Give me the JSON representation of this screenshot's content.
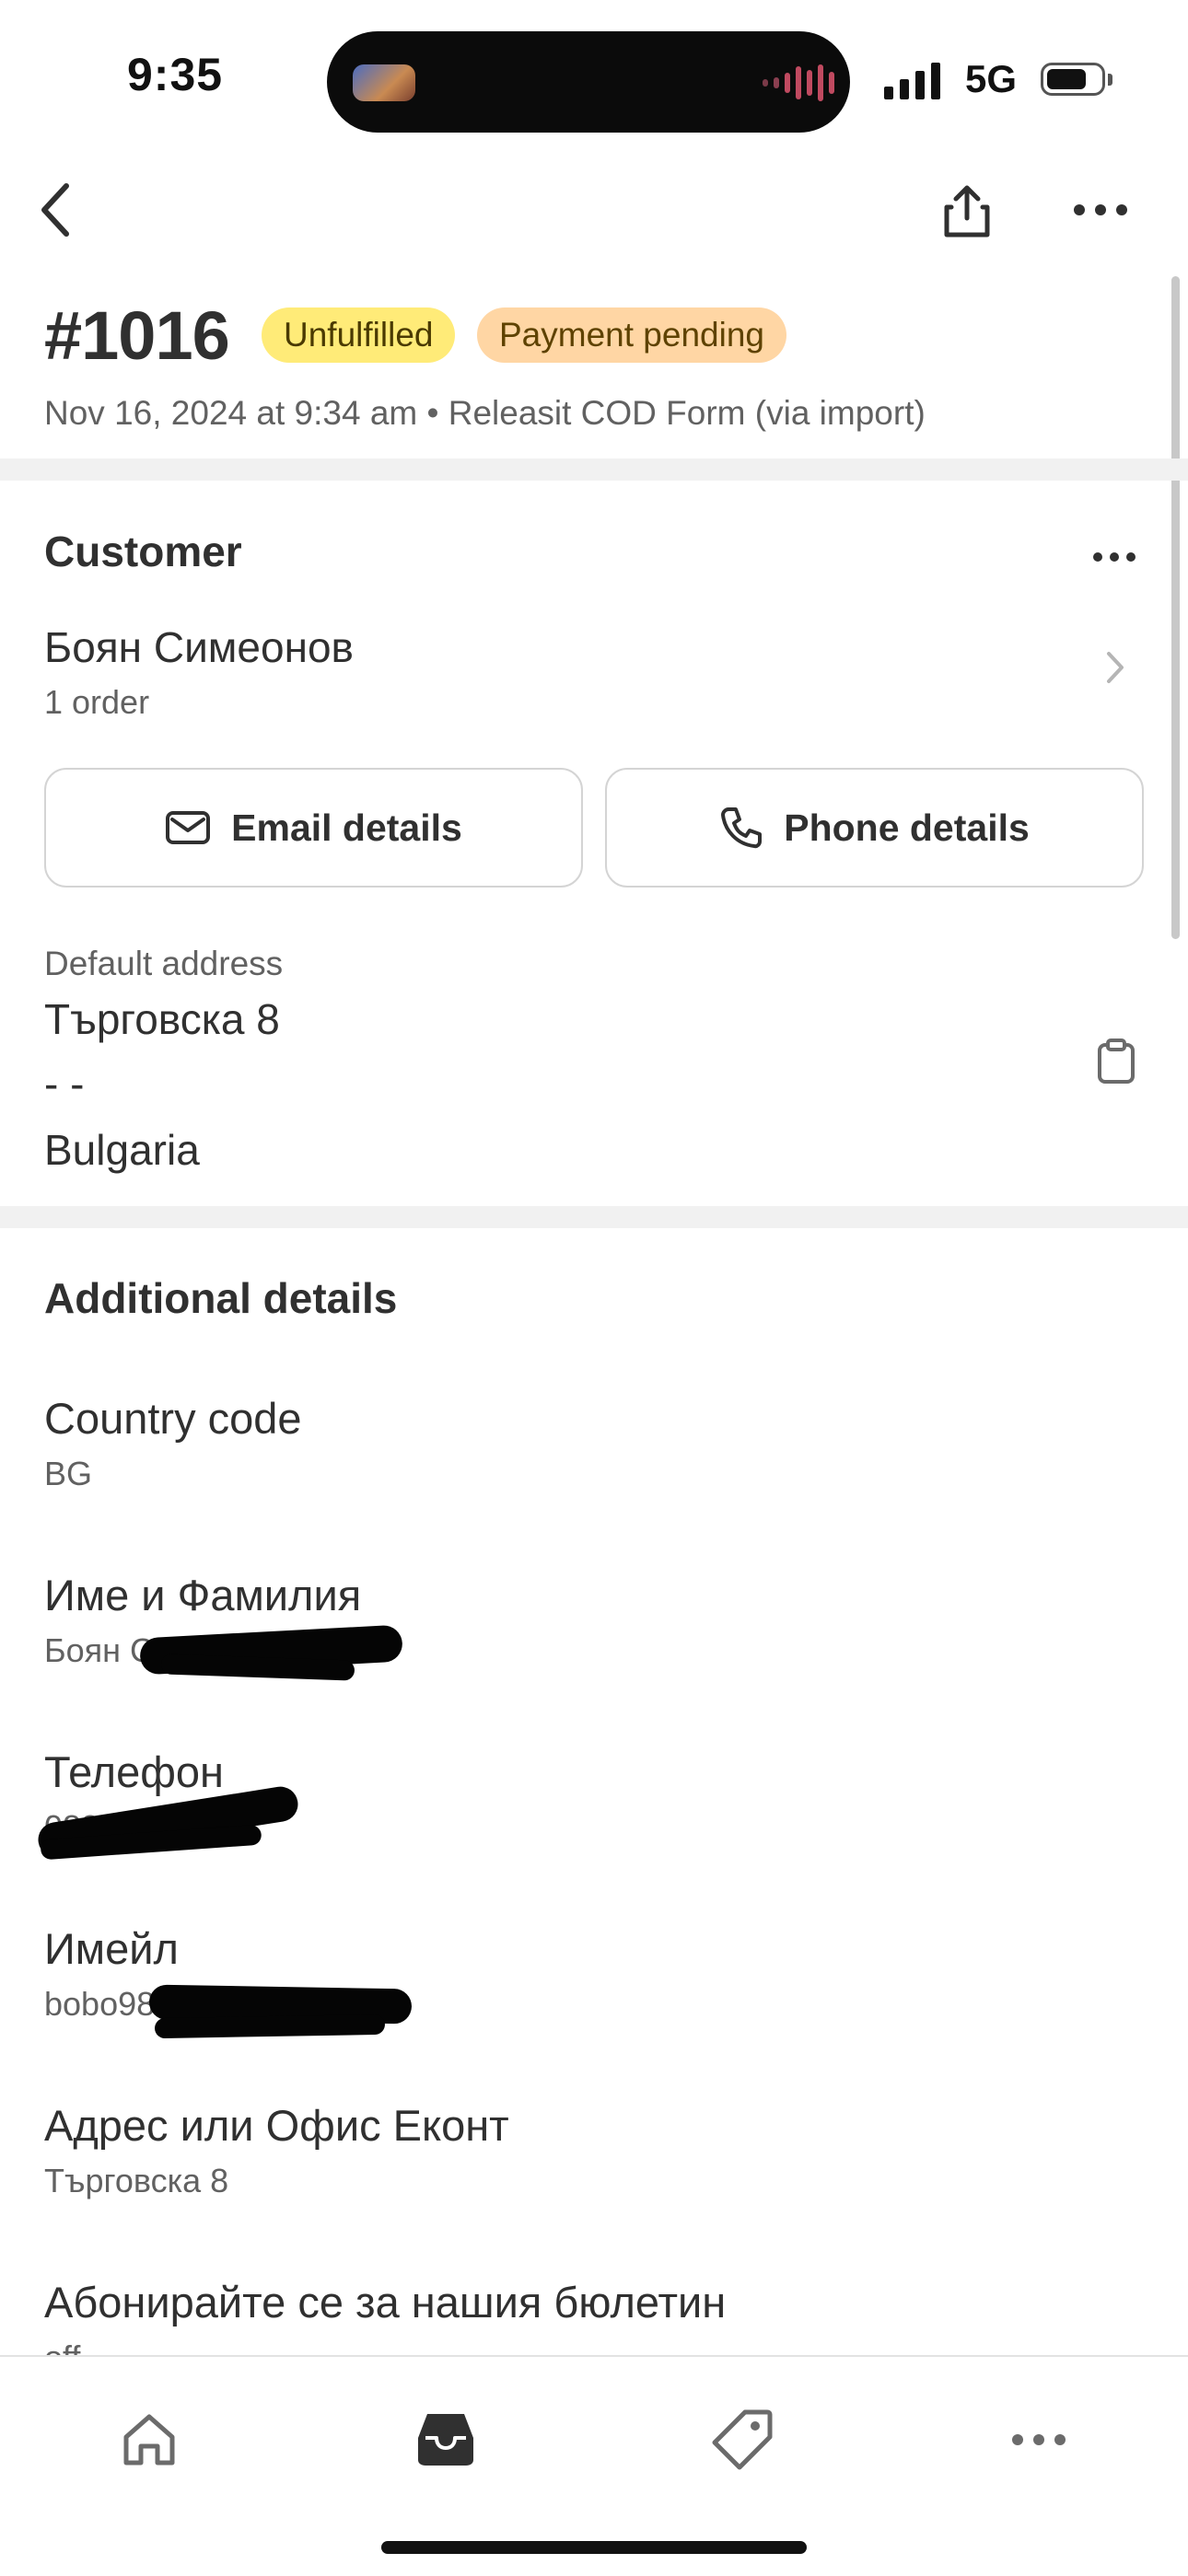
{
  "status_bar": {
    "time": "9:35",
    "network": "5G"
  },
  "order": {
    "number": "#1016",
    "badges": {
      "fulfillment": "Unfulfilled",
      "payment": "Payment pending"
    },
    "subtitle": "Nov 16, 2024 at 9:34 am • Releasit COD Form (via import)"
  },
  "customer": {
    "heading": "Customer",
    "name": "Боян Симеонов",
    "orders": "1 order",
    "email_button": "Email details",
    "phone_button": "Phone details",
    "address_label": "Default address",
    "address_lines": [
      "Търговска 8",
      "- -",
      "Bulgaria"
    ]
  },
  "additional": {
    "heading": "Additional details",
    "fields": [
      {
        "label": "Country code",
        "value": "BG"
      },
      {
        "label": "Име и Фамилия",
        "value": "Боян С"
      },
      {
        "label": "Телефон",
        "value": "08840"
      },
      {
        "label": "Имейл",
        "value": "bobo98"
      },
      {
        "label": "Адрес или Офис Еконт",
        "value": "Търговска 8"
      },
      {
        "label": "Абонирайте се за нашия бюлетин",
        "value": "off"
      }
    ]
  },
  "colors": {
    "badge_unfulfilled": "#ffeb78",
    "badge_payment": "#ffd6a4",
    "text_primary": "#303030",
    "text_secondary": "#616161"
  },
  "tab_bar": {
    "items": [
      "home-icon",
      "orders-icon",
      "products-icon",
      "more-icon"
    ],
    "selected": "orders-icon"
  }
}
